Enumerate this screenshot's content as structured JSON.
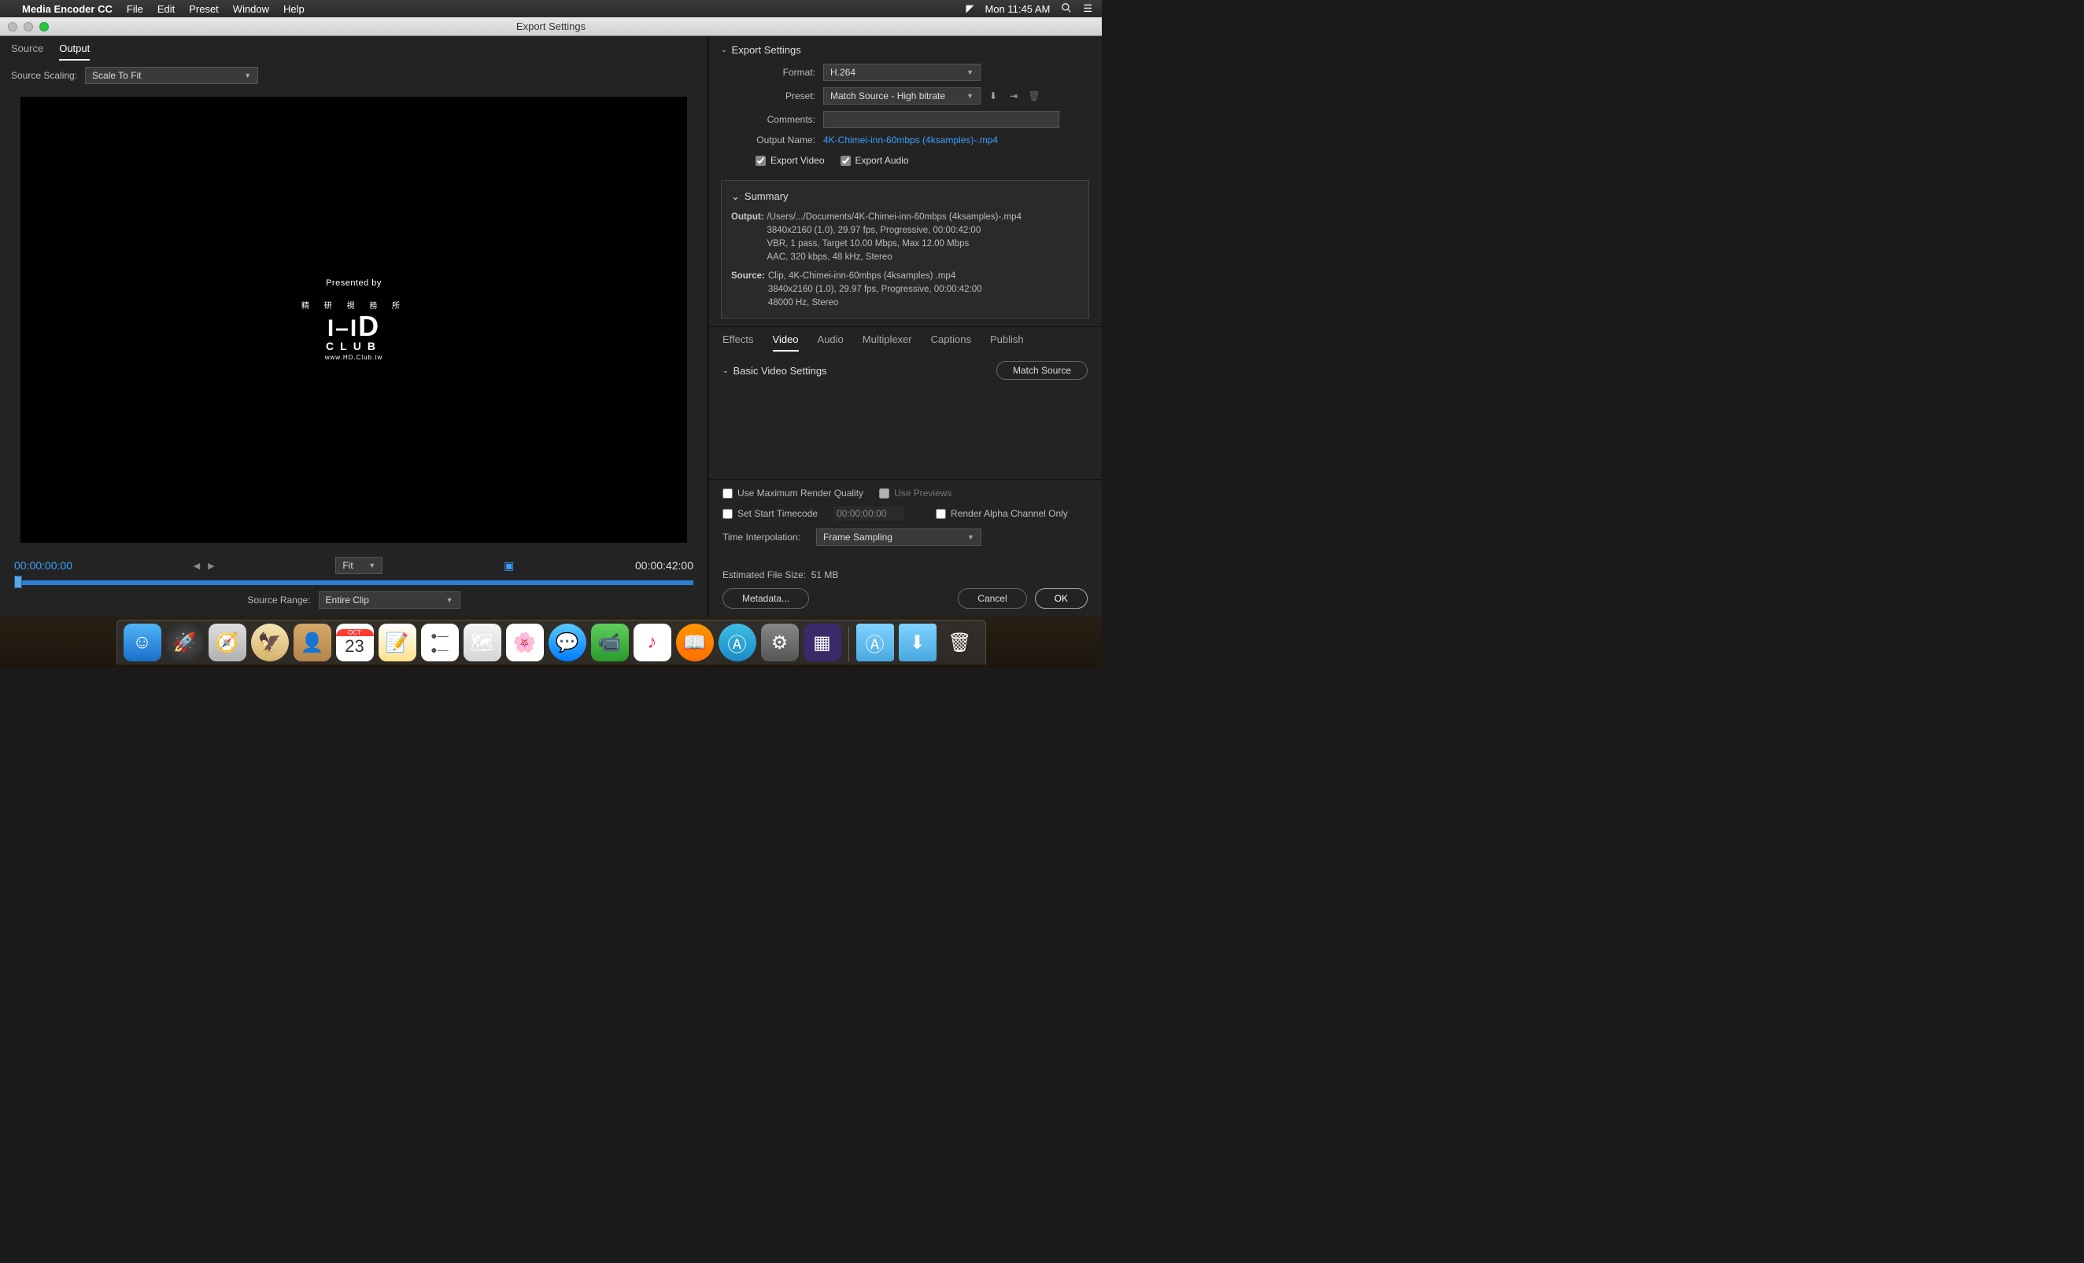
{
  "menubar": {
    "app": "Media Encoder CC",
    "items": [
      "File",
      "Edit",
      "Preset",
      "Window",
      "Help"
    ],
    "clock": "Mon 11:45 AM"
  },
  "window": {
    "title": "Export Settings"
  },
  "leftPanel": {
    "tabs": {
      "source": "Source",
      "output": "Output"
    },
    "sourceScaling": {
      "label": "Source Scaling:",
      "value": "Scale To Fit"
    },
    "preview": {
      "presented": "Presented by",
      "cjk": "精 研 視 務 所",
      "hd": "HD",
      "club": "CLUB",
      "url": "www.HD.Club.tw"
    },
    "timeline": {
      "current": "00:00:00:00",
      "duration": "00:00:42:00",
      "fit": "Fit",
      "sourceRangeLabel": "Source Range:",
      "sourceRangeValue": "Entire Clip"
    }
  },
  "rightPanel": {
    "exportSettings": {
      "title": "Export Settings",
      "formatLabel": "Format:",
      "formatValue": "H.264",
      "presetLabel": "Preset:",
      "presetValue": "Match Source - High bitrate",
      "commentsLabel": "Comments:",
      "commentsValue": "",
      "outputNameLabel": "Output Name:",
      "outputNameValue": "4K-Chimei-inn-60mbps (4ksamples)-.mp4",
      "exportVideo": "Export Video",
      "exportAudio": "Export Audio"
    },
    "summary": {
      "title": "Summary",
      "outputLabel": "Output:",
      "outputLines": [
        "/Users/.../Documents/4K-Chimei-inn-60mbps (4ksamples)-.mp4",
        "3840x2160 (1.0), 29.97 fps, Progressive, 00:00:42:00",
        "VBR, 1 pass, Target 10.00 Mbps, Max 12.00 Mbps",
        "AAC, 320 kbps, 48 kHz, Stereo"
      ],
      "sourceLabel": "Source:",
      "sourceLines": [
        "Clip, 4K-Chimei-inn-60mbps (4ksamples) .mp4",
        "3840x2160 (1.0), 29.97 fps, Progressive, 00:00:42:00",
        "48000 Hz, Stereo"
      ]
    },
    "midTabs": [
      "Effects",
      "Video",
      "Audio",
      "Multiplexer",
      "Captions",
      "Publish"
    ],
    "basicVideo": {
      "title": "Basic Video Settings",
      "matchSource": "Match Source"
    },
    "bottomOptions": {
      "maxQuality": "Use Maximum Render Quality",
      "usePreviews": "Use Previews",
      "setStartTC": "Set Start Timecode",
      "tcValue": "00:00:00:00",
      "renderAlpha": "Render Alpha Channel Only",
      "timeInterpLabel": "Time Interpolation:",
      "timeInterpValue": "Frame Sampling"
    },
    "footer": {
      "fileSizeLabel": "Estimated File Size:",
      "fileSizeValue": "51 MB",
      "metadata": "Metadata...",
      "cancel": "Cancel",
      "ok": "OK"
    }
  },
  "dock": {
    "cal": {
      "month": "OCT",
      "day": "23"
    }
  }
}
